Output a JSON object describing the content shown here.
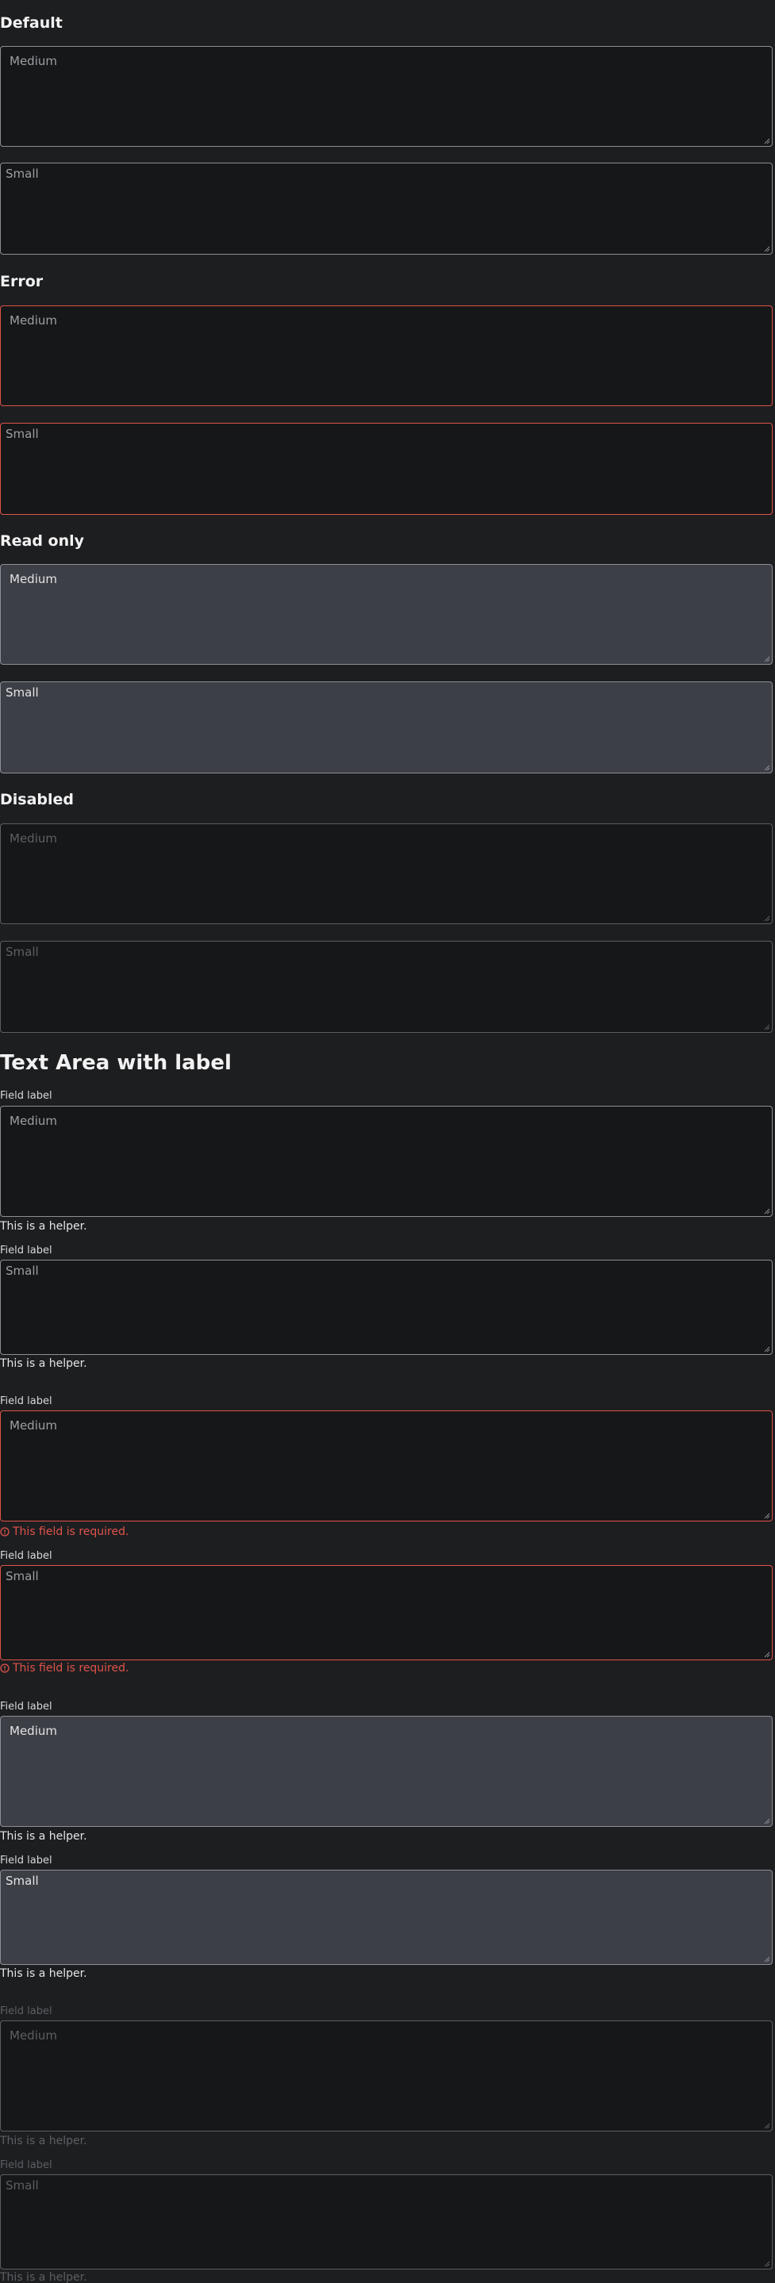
{
  "sections": {
    "default": "Default",
    "error": "Error",
    "readonly": "Read only",
    "disabled": "Disabled",
    "with_label": "Text Area with label"
  },
  "placeholders": {
    "medium": "Medium",
    "small": "Small"
  },
  "field_label": "Field label",
  "helper_text": "This is a helper.",
  "error_text": "This field is required.",
  "colors": {
    "background": "#1d1e20",
    "field": "#161719",
    "readonly_field": "#3d3f47",
    "border": "#8c8f96",
    "error": "#e0534a"
  }
}
